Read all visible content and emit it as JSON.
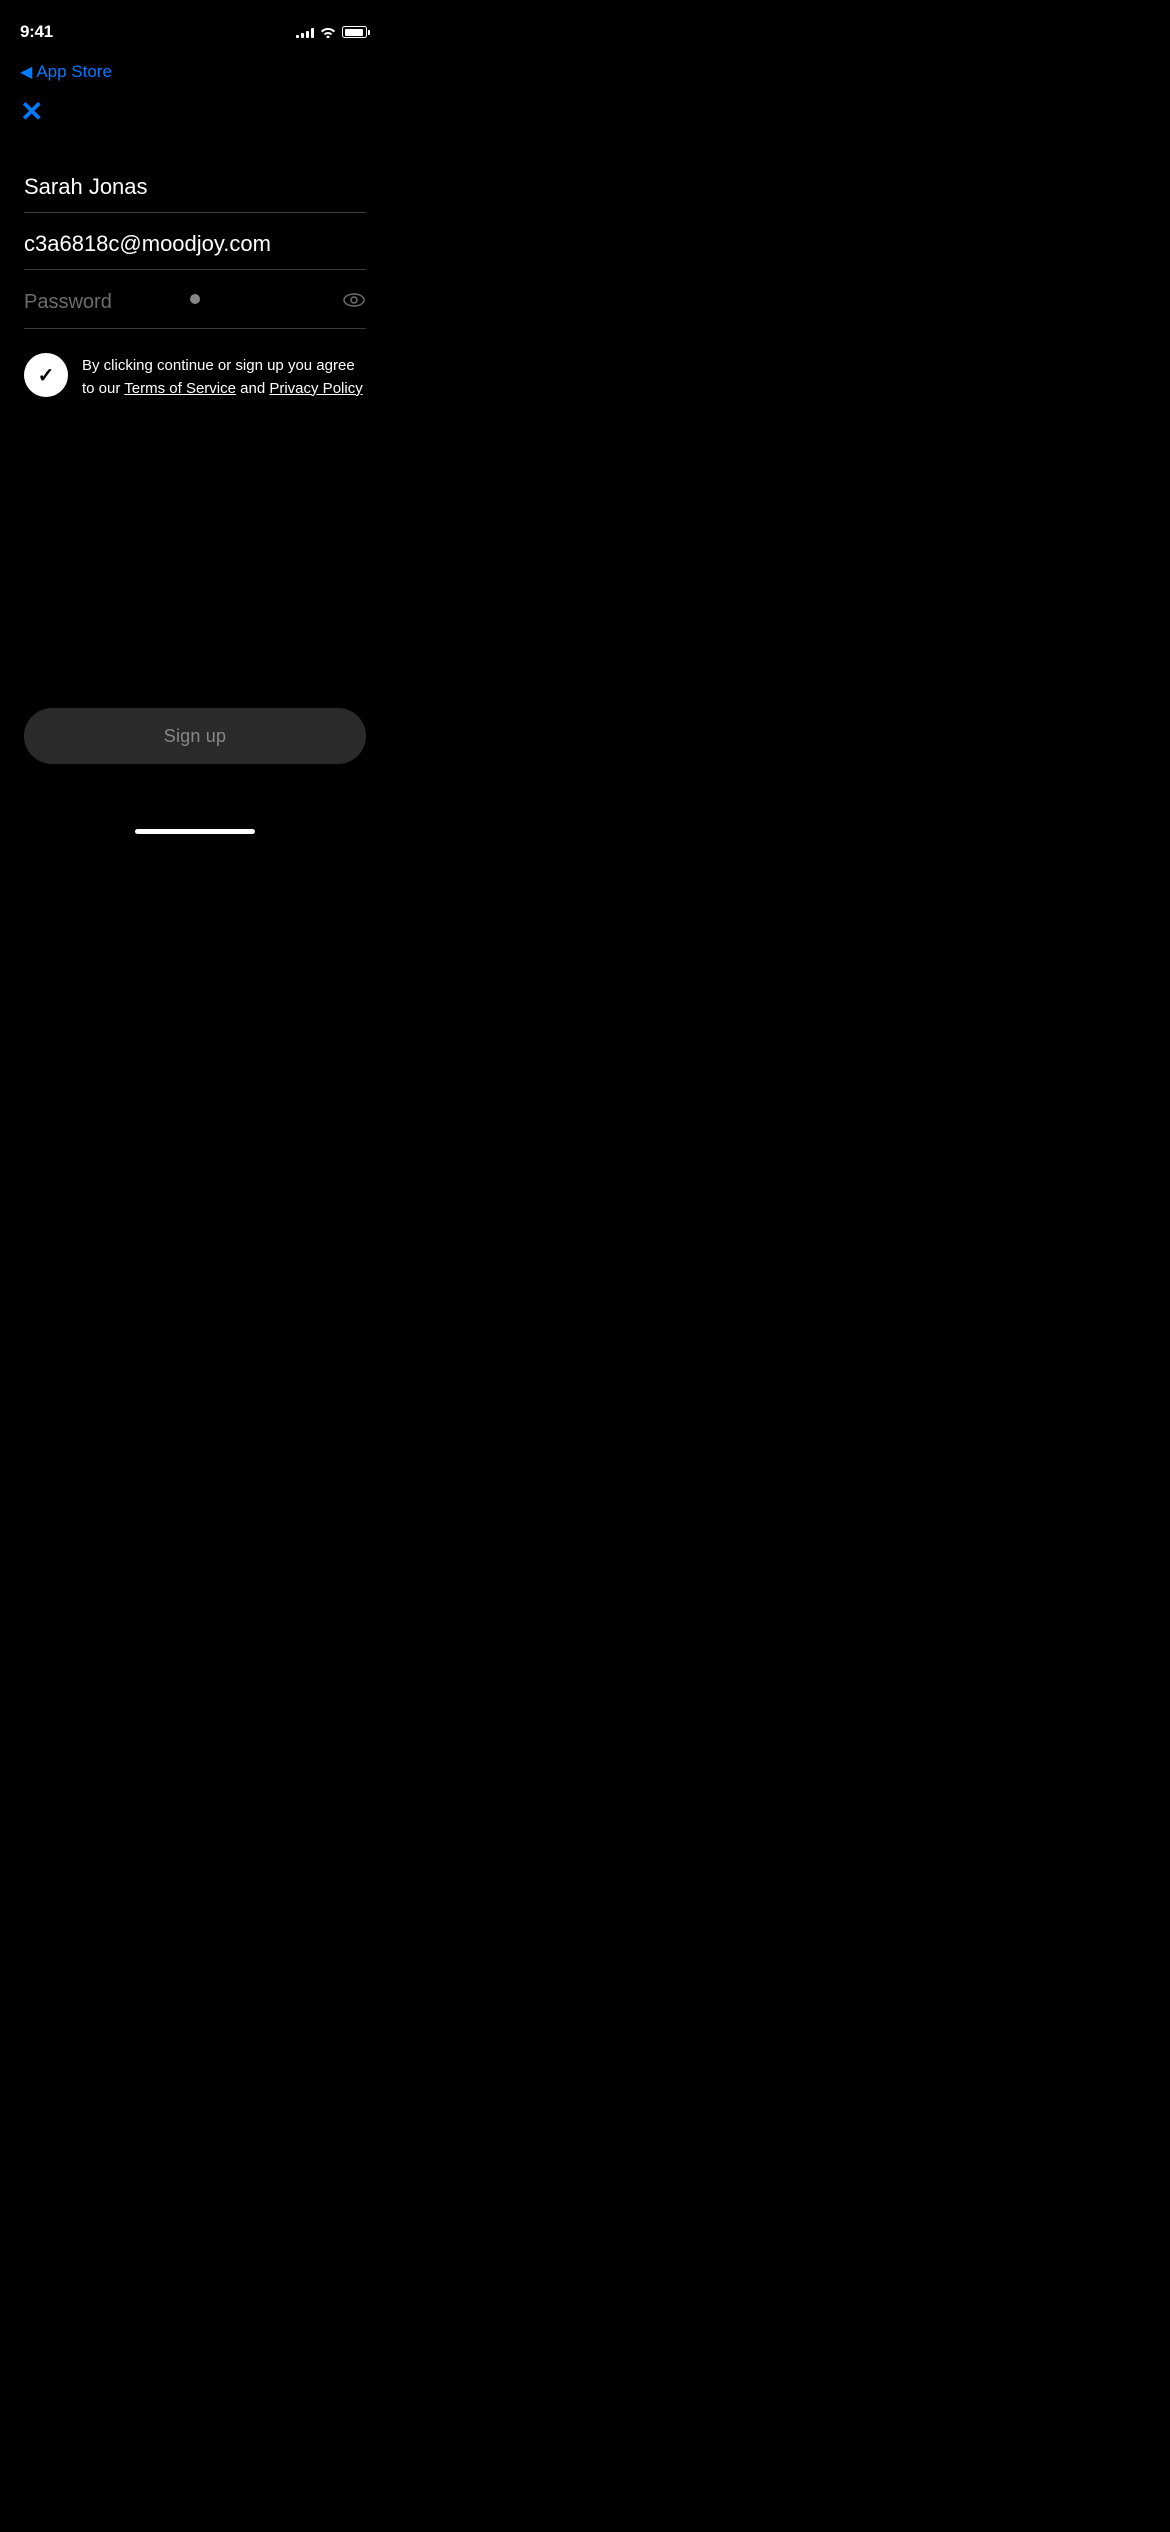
{
  "statusBar": {
    "time": "9:41",
    "backLabel": "App Store",
    "signalBars": [
      3,
      5,
      7,
      9,
      11
    ],
    "accentColor": "#007AFF"
  },
  "form": {
    "nameValue": "Sarah Jonas",
    "emailValue": "c3a6818c@moodjoy.com",
    "passwordPlaceholder": "Password",
    "passwordHasValue": true,
    "termsText": "By clicking continue or sign up you agree to our ",
    "termsOfServiceLabel": "Terms of Service",
    "termsAndLabel": " and ",
    "privacyPolicyLabel": "Privacy Policy",
    "checkboxChecked": true
  },
  "buttons": {
    "closeLabel": "✕",
    "signUpLabel": "Sign up"
  }
}
